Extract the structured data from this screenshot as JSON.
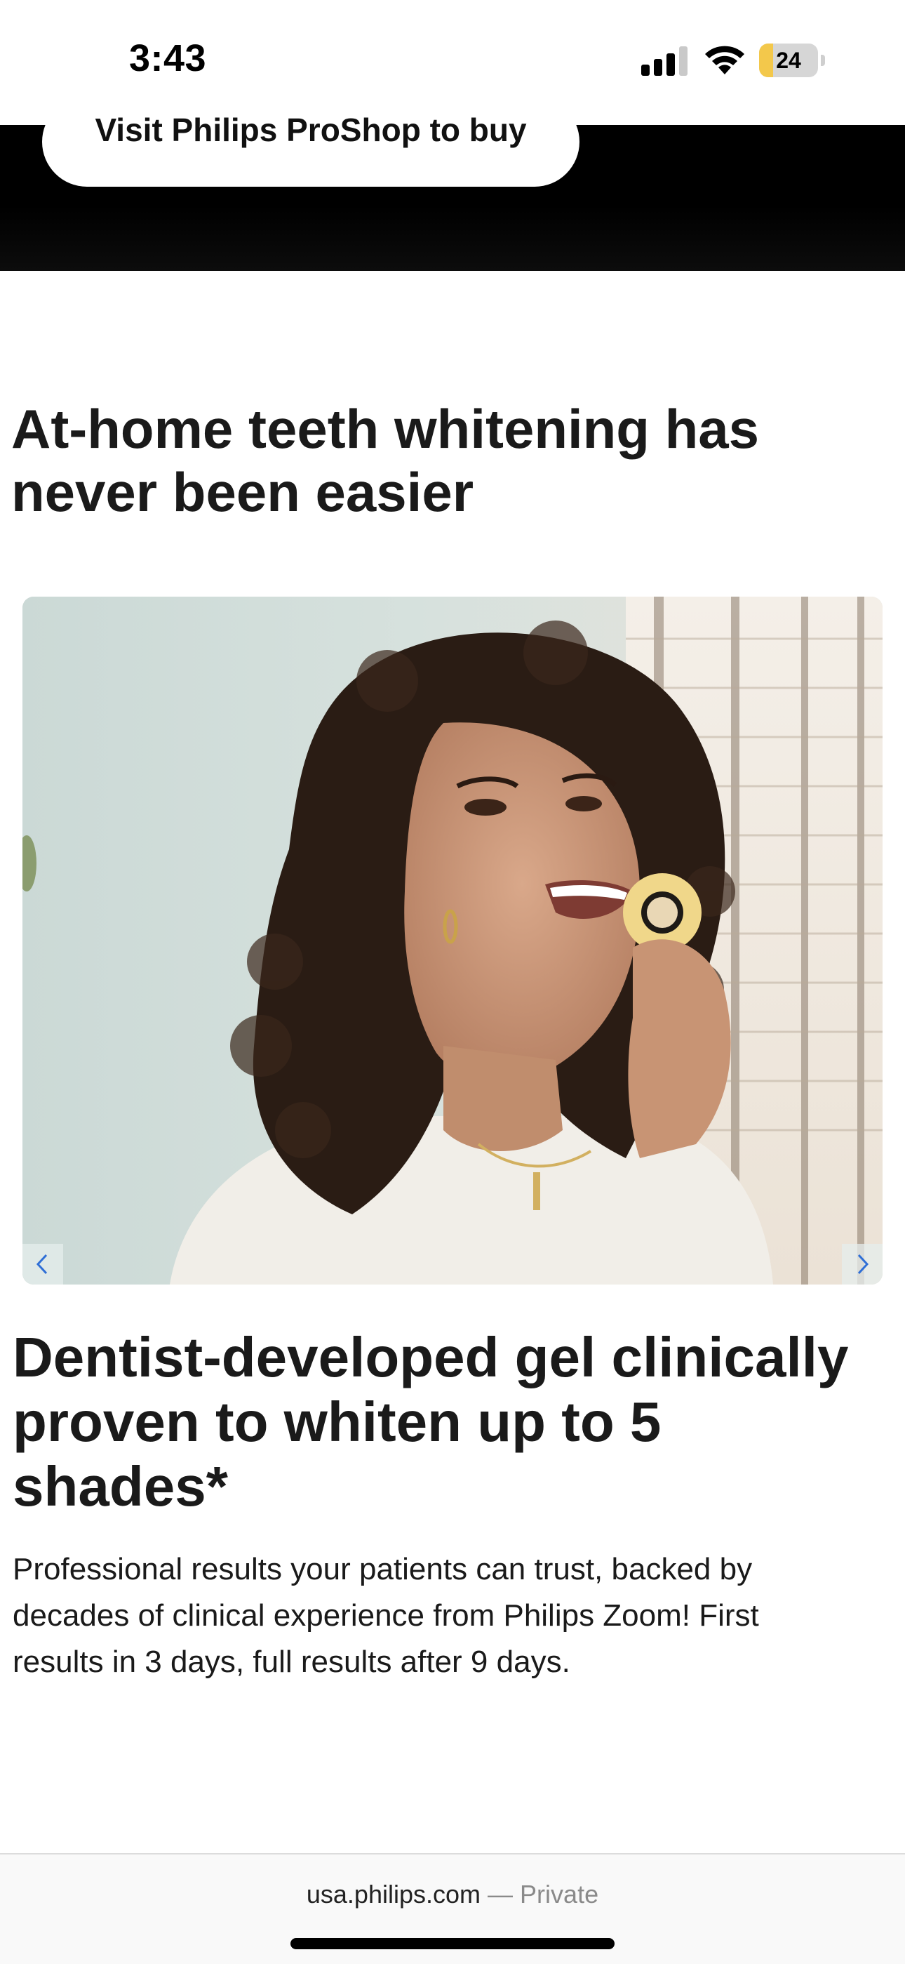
{
  "status_bar": {
    "time": "3:43",
    "battery_level": "24",
    "icons": [
      "signal-icon",
      "wifi-icon",
      "battery-icon"
    ]
  },
  "hero": {
    "cta_label": "Visit Philips ProShop to buy"
  },
  "content": {
    "heading": "At-home teeth whitening has never been easier",
    "carousel": {
      "image_alt": "Woman holding a whitening shade guide to her teeth",
      "prev_icon": "chevron-left-icon",
      "next_icon": "chevron-right-icon",
      "arrow_color": "#2f6fd6"
    },
    "feature_title": "Dentist-developed gel clinically proven to whiten up to 5 shades*",
    "feature_body": "Professional results your patients can trust, backed by decades of clinical experience from Philips Zoom! First results in 3 days, full results after 9 days."
  },
  "browser": {
    "domain": "usa.philips.com",
    "separator": "—",
    "mode": "Private"
  },
  "colors": {
    "hero_band": "#000000",
    "text": "#1a1a1a",
    "battery_fill": "#f3c84b"
  }
}
